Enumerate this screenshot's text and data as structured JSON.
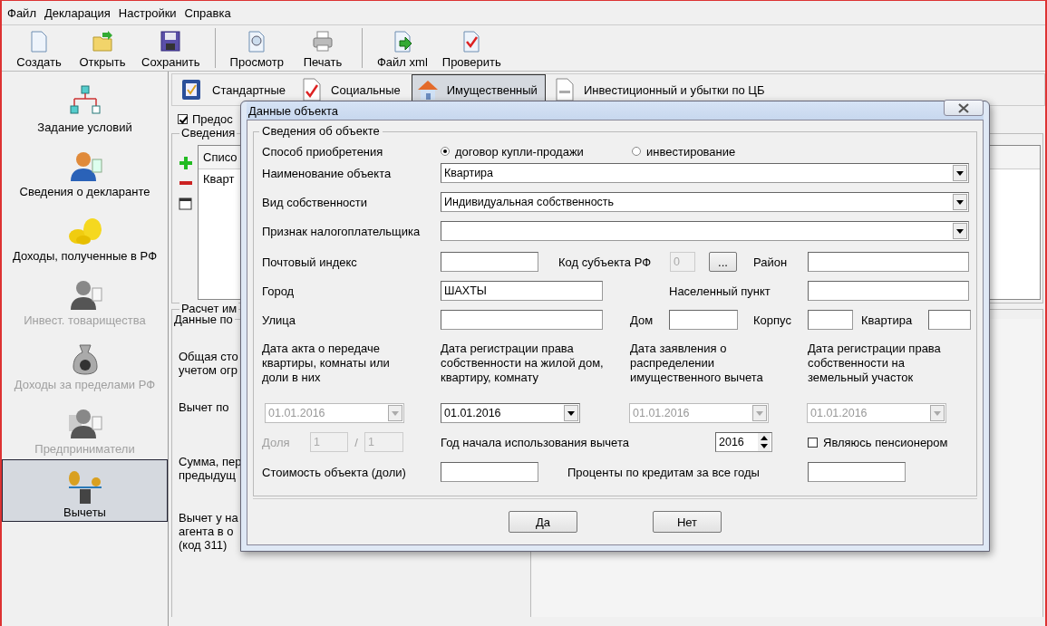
{
  "menu": [
    "Файл",
    "Декларация",
    "Настройки",
    "Справка"
  ],
  "toolbar": [
    {
      "buttons": [
        {
          "label": "Создать",
          "kind": "new"
        },
        {
          "label": "Открыть",
          "kind": "open"
        },
        {
          "label": "Сохранить",
          "kind": "save"
        }
      ]
    },
    {
      "buttons": [
        {
          "label": "Просмотр",
          "kind": "preview"
        },
        {
          "label": "Печать",
          "kind": "print"
        }
      ]
    },
    {
      "buttons": [
        {
          "label": "Файл xml",
          "kind": "xml"
        },
        {
          "label": "Проверить",
          "kind": "check"
        }
      ]
    }
  ],
  "sidebar": [
    {
      "label": "Задание условий",
      "kind": "flow",
      "selected": false,
      "disabled": false
    },
    {
      "label": "Сведения о декларанте",
      "kind": "person",
      "selected": false,
      "disabled": false
    },
    {
      "label": "Доходы, полученные в РФ",
      "kind": "coins",
      "selected": false,
      "disabled": false
    },
    {
      "label": "Инвест. товарищества",
      "kind": "person",
      "selected": false,
      "disabled": true
    },
    {
      "label": "Доходы за пределами РФ",
      "kind": "bag",
      "selected": false,
      "disabled": true
    },
    {
      "label": "Предприниматели",
      "kind": "people",
      "selected": false,
      "disabled": true
    },
    {
      "label": "Вычеты",
      "kind": "scales",
      "selected": true,
      "disabled": false
    }
  ],
  "tabs": [
    {
      "label": "Стандартные",
      "kind": "pen",
      "selected": false
    },
    {
      "label": "Социальные",
      "kind": "check",
      "selected": false
    },
    {
      "label": "Имущественный",
      "kind": "house",
      "selected": true
    },
    {
      "label": "Инвестиционный и убытки по ЦБ",
      "kind": "doc",
      "selected": false
    }
  ],
  "background": {
    "checkbox": {
      "label": "Предос",
      "checked": true
    },
    "info_group": "Сведения",
    "list_header": "Списо",
    "list_rows": [
      "Кварт"
    ],
    "calc_group": "Расчет им",
    "data_group": "Данные по",
    "texts": [
      {
        "lines": [
          "Общая сто",
          "учетом огр"
        ]
      },
      {
        "lines": [
          "Вычет по"
        ]
      },
      {
        "lines": [
          "Сумма, пер",
          "предыдущ"
        ]
      },
      {
        "lines": [
          "Вычет у на",
          "агента в о",
          "(код 311)"
        ]
      }
    ]
  },
  "dialog": {
    "title": "Данные объекта",
    "section": "Сведения об объекте",
    "acquisition": {
      "label": "Способ приобретения",
      "options": [
        {
          "label": "договор купли-продажи",
          "selected": true
        },
        {
          "label": "инвестирование",
          "selected": false
        }
      ]
    },
    "object_name": {
      "label": "Наименование объекта",
      "value": "Квартира"
    },
    "ownership": {
      "label": "Вид собственности",
      "value": "Индивидуальная собственность"
    },
    "taxpayer_sign": {
      "label": "Признак налогоплательщика"
    },
    "postal_index": {
      "label": "Почтовый индекс"
    },
    "region_code": {
      "label": "Код субъекта РФ",
      "value": "0",
      "disabled": true,
      "button": "..."
    },
    "district": {
      "label": "Район"
    },
    "city": {
      "label": "Город",
      "value": "ШАХТЫ"
    },
    "locality": {
      "label": "Населенный пункт"
    },
    "street": {
      "label": "Улица"
    },
    "house": {
      "label": "Дом"
    },
    "building": {
      "label": "Корпус"
    },
    "apartment": {
      "label": "Квартира"
    },
    "dates": [
      {
        "label": "Дата акта о передаче квартиры, комнаты или доли в них",
        "value": "01.01.2016",
        "disabled": true
      },
      {
        "label": "Дата регистрации права собственности на жилой дом, квартиру, комнату",
        "value": "01.01.2016",
        "disabled": false
      },
      {
        "label": "Дата заявления о распределении имущественного вычета",
        "value": "01.01.2016",
        "disabled": true
      },
      {
        "label": "Дата регистрации права собственности на земельный участок",
        "value": "01.01.2016",
        "disabled": true
      }
    ],
    "share": {
      "label": "Доля",
      "numerator": "1",
      "separator": "/",
      "denominator": "1",
      "disabled": true
    },
    "start_year": {
      "label": "Год начала использования вычета",
      "value": "2016"
    },
    "pensioner": {
      "label": "Являюсь пенсионером",
      "checked": false
    },
    "cost": {
      "label": "Стоимость объекта (доли)"
    },
    "interest": {
      "label": "Проценты по кредитам за все годы"
    },
    "buttons": [
      "Да",
      "Нет"
    ]
  }
}
